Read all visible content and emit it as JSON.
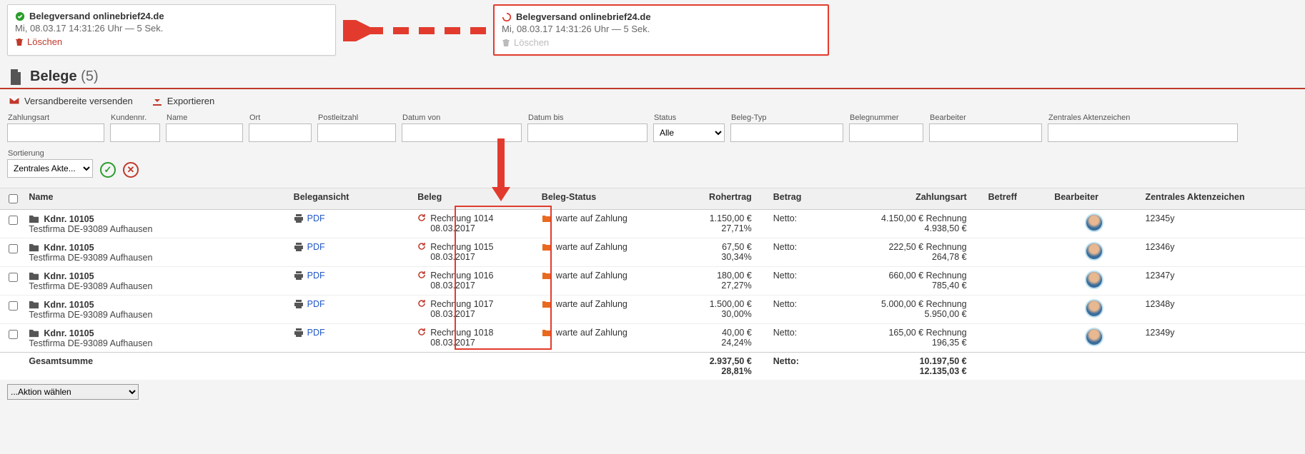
{
  "cards": {
    "left": {
      "title": "Belegversand onlinebrief24.de",
      "ts": "Mi, 08.03.17 14:31:26 Uhr — 5 Sek.",
      "del": "Löschen"
    },
    "right": {
      "title": "Belegversand onlinebrief24.de",
      "ts": "Mi, 08.03.17 14:31:26 Uhr — 5 Sek.",
      "del": "Löschen"
    }
  },
  "section": {
    "title": "Belege",
    "count": "(5)"
  },
  "toolbar": {
    "send": "Versandbereite versenden",
    "export": "Exportieren"
  },
  "filters": {
    "zahlungsart": "Zahlungsart",
    "kundennr": "Kundennr.",
    "name": "Name",
    "ort": "Ort",
    "plz": "Postleitzahl",
    "datumvon": "Datum von",
    "datumbis": "Datum bis",
    "status_lbl": "Status",
    "status_val": "Alle",
    "belegtyp": "Beleg-Typ",
    "belegnummer": "Belegnummer",
    "bearbeiter": "Bearbeiter",
    "zak": "Zentrales Aktenzeichen",
    "sort_lbl": "Sortierung",
    "sort_val": "Zentrales Akte..."
  },
  "headers": {
    "name": "Name",
    "belegansicht": "Belegansicht",
    "beleg": "Beleg",
    "belegstatus": "Beleg-Status",
    "rohertrag": "Rohertrag",
    "betrag": "Betrag",
    "zahlungsart": "Zahlungsart",
    "betreff": "Betreff",
    "bearbeiter": "Bearbeiter",
    "zak": "Zentrales Aktenzeichen"
  },
  "common": {
    "pdf": "PDF",
    "status": "warte auf Zahlung",
    "betrag": "Netto:",
    "zahlungsart": "Rechnung",
    "name_main": "Kdnr. 10105",
    "name_sub": "Testfirma DE-93089 Aufhausen"
  },
  "rows": [
    {
      "beleg": "Rechnung 1014",
      "date": "08.03.2017",
      "roh1": "1.150,00 €",
      "roh2": "27,71%",
      "z1": "4.150,00 €",
      "z2": "4.938,50 €",
      "zak": "12345y"
    },
    {
      "beleg": "Rechnung 1015",
      "date": "08.03.2017",
      "roh1": "67,50 €",
      "roh2": "30,34%",
      "z1": "222,50 €",
      "z2": "264,78 €",
      "zak": "12346y"
    },
    {
      "beleg": "Rechnung 1016",
      "date": "08.03.2017",
      "roh1": "180,00 €",
      "roh2": "27,27%",
      "z1": "660,00 €",
      "z2": "785,40 €",
      "zak": "12347y"
    },
    {
      "beleg": "Rechnung 1017",
      "date": "08.03.2017",
      "roh1": "1.500,00 €",
      "roh2": "30,00%",
      "z1": "5.000,00 €",
      "z2": "5.950,00 €",
      "zak": "12348y"
    },
    {
      "beleg": "Rechnung 1018",
      "date": "08.03.2017",
      "roh1": "40,00 €",
      "roh2": "24,24%",
      "z1": "165,00 €",
      "z2": "196,35 €",
      "zak": "12349y"
    }
  ],
  "totals": {
    "label": "Gesamtsumme",
    "roh1": "2.937,50 €",
    "roh2": "28,81%",
    "betrag": "Netto:",
    "z1": "10.197,50 €",
    "z2": "12.135,03 €"
  },
  "bottom": {
    "action": "...Aktion wählen"
  }
}
